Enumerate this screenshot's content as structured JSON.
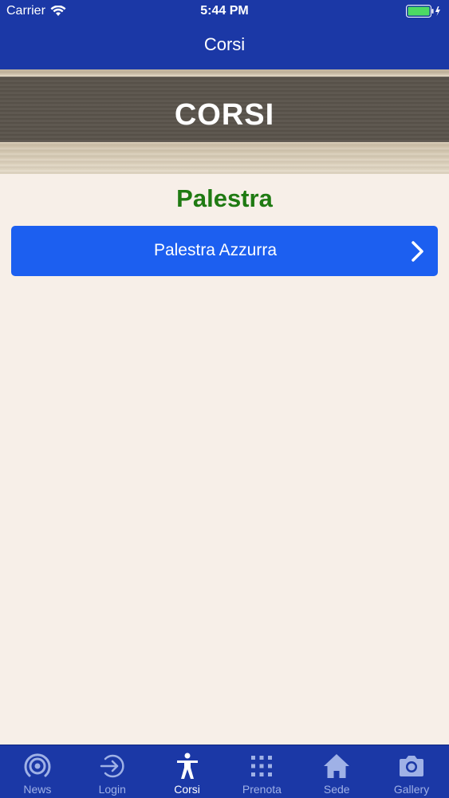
{
  "status_bar": {
    "carrier": "Carrier",
    "time": "5:44 PM"
  },
  "nav": {
    "title": "Corsi"
  },
  "banner": {
    "title": "CORSI"
  },
  "section": {
    "heading": "Palestra"
  },
  "courses": [
    {
      "label": "Palestra Azzurra"
    }
  ],
  "tabs": [
    {
      "label": "News",
      "icon": "broadcast-icon"
    },
    {
      "label": "Login",
      "icon": "login-icon"
    },
    {
      "label": "Corsi",
      "icon": "person-icon",
      "active": true
    },
    {
      "label": "Prenota",
      "icon": "grid-icon"
    },
    {
      "label": "Sede",
      "icon": "home-icon"
    },
    {
      "label": "Gallery",
      "icon": "camera-icon"
    }
  ],
  "colors": {
    "nav_background": "#1b38a6",
    "button_background": "#1c5ff0",
    "heading_green": "#1f7a12",
    "page_background": "#f7efe8"
  }
}
